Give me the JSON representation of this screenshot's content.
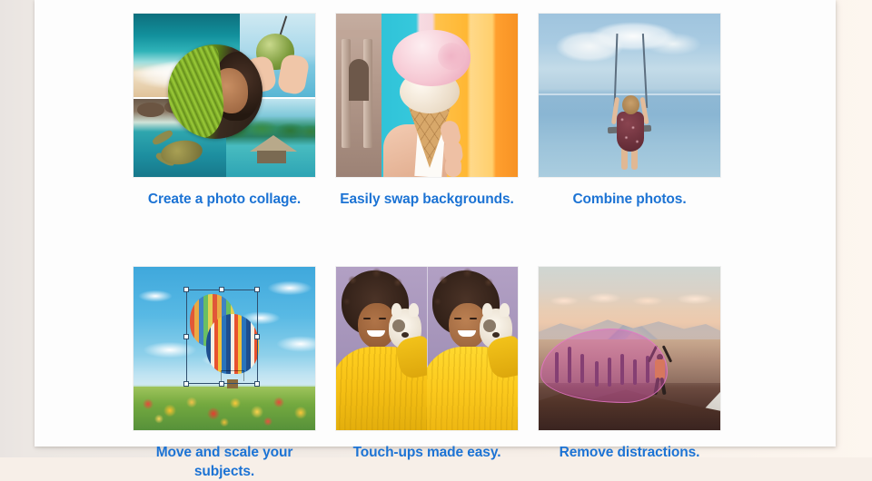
{
  "page": {
    "background_color": "#f3ece6",
    "panel_color": "#fdfdfd",
    "accent_link_color": "#1c73d4"
  },
  "grid": {
    "rows": [
      {
        "cards": [
          {
            "caption": "Create a photo collage.",
            "image_name": "photo-collage-thumbnail",
            "image_alt": "Tropical photo collage: ocean wave on sand, coconut drink in hands, circular portrait of woman with palm leaf, sea turtle, overwater bungalow"
          },
          {
            "caption": "Easily swap backgrounds.",
            "image_name": "swap-backgrounds-thumbnail",
            "image_alt": "Hand holding a pink and vanilla ice cream cone against a teal and orange striped background with a classical building"
          },
          {
            "caption": "Combine photos.",
            "image_name": "combine-photos-thumbnail",
            "image_alt": "Girl on a swing hanging above a calm blue sea under clouds"
          }
        ]
      },
      {
        "cards": [
          {
            "caption": "Move and scale your subjects.",
            "image_name": "move-scale-subjects-thumbnail",
            "image_alt": "Hot air balloons over a tulip field with an eight-handle selection bounding box and a mouse cursor"
          },
          {
            "caption": "Touch-ups made easy.",
            "image_name": "touch-ups-thumbnail",
            "image_alt": "Before and after split portrait of a woman in a yellow sweater holding a white puppy on a purple background"
          },
          {
            "caption": "Remove distractions.",
            "image_name": "remove-distractions-thumbnail",
            "image_alt": "Mountain sunset with a person raising their arms and a pink selection blob over a group of people to be removed"
          }
        ]
      }
    ]
  }
}
